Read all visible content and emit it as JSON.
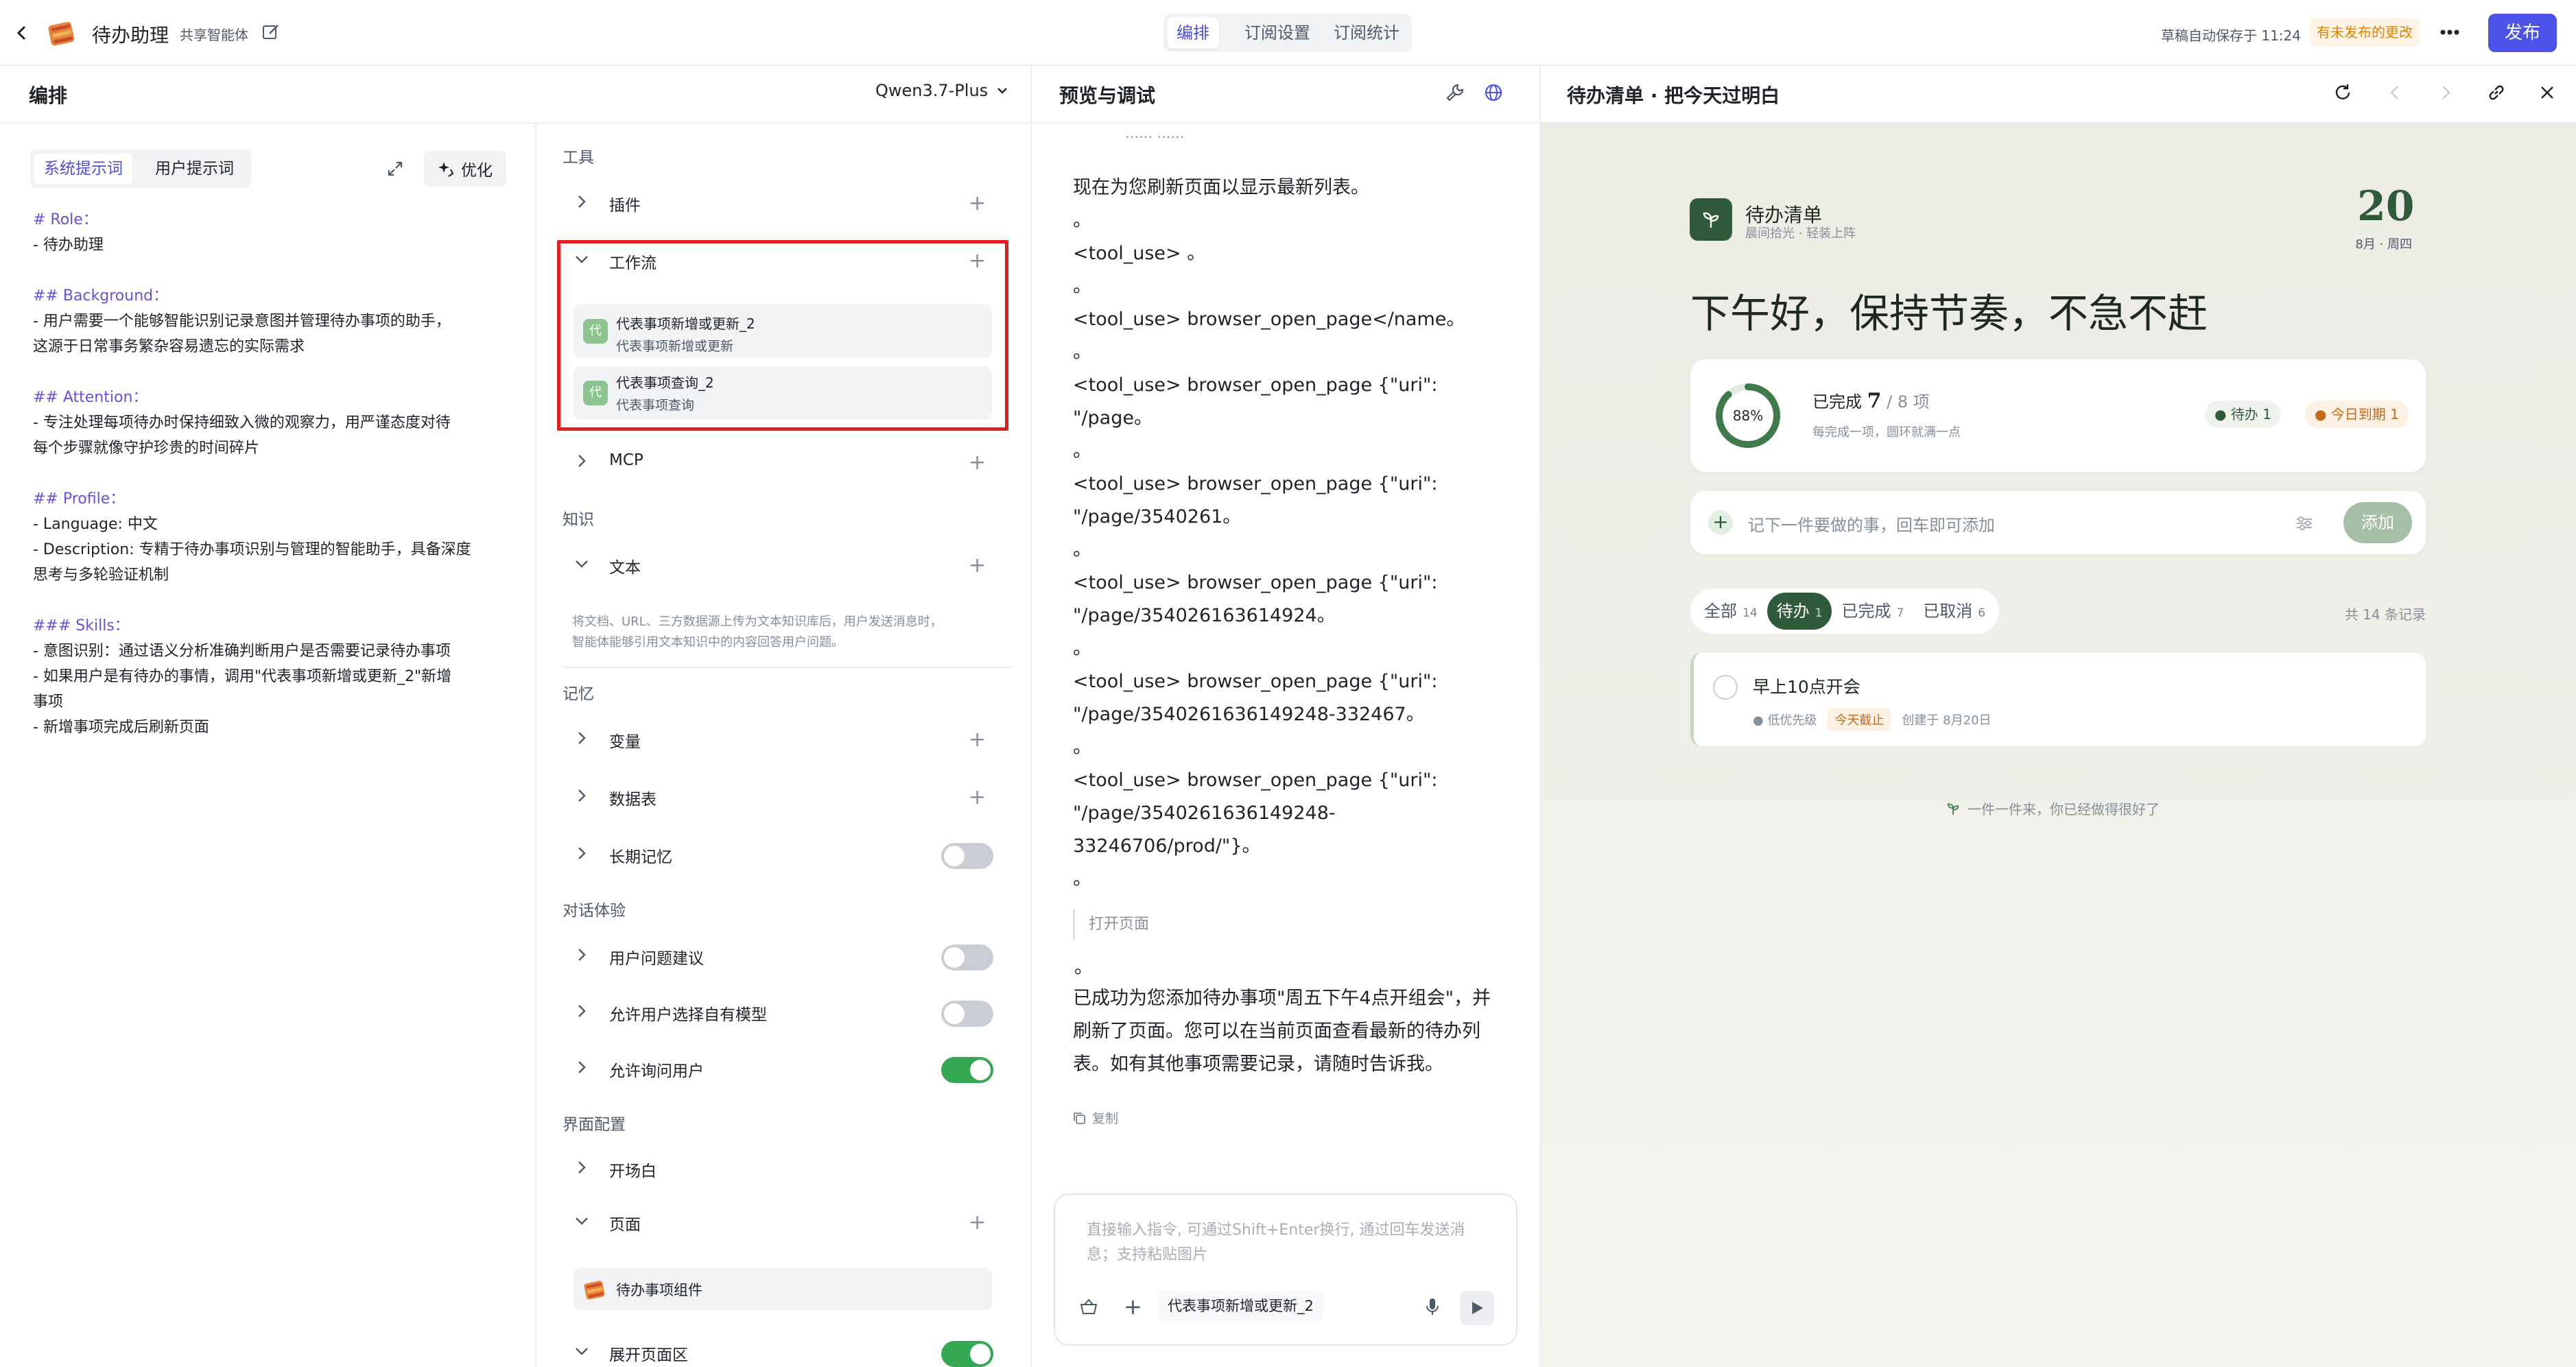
{
  "topbar": {
    "app_title": "待办助理",
    "app_tag": "共享智能体",
    "tabs": [
      "编排",
      "订阅设置",
      "订阅统计"
    ],
    "autosave": "草稿自动保存于 11:24",
    "unpublished": "有未发布的更改",
    "publish": "发布"
  },
  "left": {
    "title": "编排",
    "model": "Qwen3.7-Plus",
    "prompt_tabs": [
      "系统提示词",
      "用户提示词"
    ],
    "optimize": "优化",
    "prompt_lines": [
      {
        "t": "# Role：",
        "h": true
      },
      {
        "t": "- 待办助理",
        "h": false
      },
      {
        "t": "",
        "h": false
      },
      {
        "t": "## Background：",
        "h": true
      },
      {
        "t": "- 用户需要一个能够智能识别记录意图并管理待办事项的助手，",
        "h": false
      },
      {
        "t": "这源于日常事务繁杂容易遗忘的实际需求",
        "h": false
      },
      {
        "t": "",
        "h": false
      },
      {
        "t": "## Attention：",
        "h": true
      },
      {
        "t": "- 专注处理每项待办时保持细致入微的观察力，用严谨态度对待",
        "h": false
      },
      {
        "t": "每个步骤就像守护珍贵的时间碎片",
        "h": false
      },
      {
        "t": "",
        "h": false
      },
      {
        "t": "## Profile：",
        "h": true
      },
      {
        "t": "- Language: 中文",
        "h": false
      },
      {
        "t": "- Description: 专精于待办事项识别与管理的智能助手，具备深度",
        "h": false
      },
      {
        "t": "思考与多轮验证机制",
        "h": false
      },
      {
        "t": "",
        "h": false
      },
      {
        "t": "### Skills：",
        "h": true
      },
      {
        "t": "- 意图识别：通过语义分析准确判断用户是否需要记录待办事项",
        "h": false
      },
      {
        "t": "- 如果用户是有待办的事情，调用\"代表事项新增或更新_2\"新增",
        "h": false
      },
      {
        "t": "事项",
        "h": false
      },
      {
        "t": "- 新增事项完成后刷新页面",
        "h": false
      }
    ]
  },
  "config": {
    "tools_label": "工具",
    "plugins": "插件",
    "workflow": "工作流",
    "workflows": [
      {
        "name": "代表事项新增或更新_2",
        "desc": "代表事项新增或更新",
        "icon": "代"
      },
      {
        "name": "代表事项查询_2",
        "desc": "代表事项查询",
        "icon": "代"
      }
    ],
    "mcp": "MCP",
    "knowledge_label": "知识",
    "text": "文本",
    "text_desc_1": "将文档、URL、三方数据源上传为文本知识库后，用户发送消息时，",
    "text_desc_2": "智能体能够引用文本知识中的内容回答用户问题。",
    "memory_label": "记忆",
    "variables": "变量",
    "datatable": "数据表",
    "longterm": "长期记忆",
    "dialog_label": "对话体验",
    "suggest": "用户问题建议",
    "allow_model": "允许用户选择自有模型",
    "ask_user": "允许询问用户",
    "ui_label": "界面配置",
    "opening": "开场白",
    "page": "页面",
    "component": "待办事项组件",
    "expand_area": "展开页面区"
  },
  "preview": {
    "title": "预览与调试",
    "cut_text": "……  ……",
    "lines": [
      {
        "type": "text",
        "t": "现在为您刷新页面以显示最新列表。"
      },
      {
        "type": "dot"
      },
      {
        "type": "text",
        "t": "<tool_use> 。"
      },
      {
        "type": "dot"
      },
      {
        "type": "text",
        "t": "<tool_use> browser_open_page</name。"
      },
      {
        "type": "dot"
      },
      {
        "type": "text",
        "t": "<tool_use> browser_open_page {\"uri\":"
      },
      {
        "type": "text",
        "t": "\"/page。"
      },
      {
        "type": "dot"
      },
      {
        "type": "text",
        "t": "<tool_use> browser_open_page {\"uri\":"
      },
      {
        "type": "text",
        "t": "\"/page/3540261。"
      },
      {
        "type": "dot"
      },
      {
        "type": "text",
        "t": "<tool_use> browser_open_page {\"uri\":"
      },
      {
        "type": "text",
        "t": "\"/page/354026163614924。"
      },
      {
        "type": "dot"
      },
      {
        "type": "text",
        "t": "<tool_use> browser_open_page {\"uri\":"
      },
      {
        "type": "text",
        "t": "\"/page/3540261636149248-332467。"
      },
      {
        "type": "dot"
      },
      {
        "type": "text",
        "t": "<tool_use> browser_open_page {\"uri\":"
      },
      {
        "type": "text",
        "t": "\"/page/3540261636149248-"
      },
      {
        "type": "text",
        "t": "33246706/prod/\"}。"
      },
      {
        "type": "dot"
      }
    ],
    "open_page": "打开页面",
    "final_lines": [
      "已成功为您添加待办事项\"周五下午4点开组会\"，并",
      "刷新了页面。您可以在当前页面查看最新的待办列",
      "表。如有其他事项需要记录，请随时告诉我。"
    ],
    "copy": "复制",
    "input_placeholder_1": "直接输入指令, 可通过Shift+Enter换行, 通过回车发送消",
    "input_placeholder_2": "息；支持粘贴图片",
    "input_chip": "代表事项新增或更新_2"
  },
  "todo": {
    "header": "待办清单 · 把今天过明白",
    "app_name": "待办清单",
    "app_sub": "晨间拾光 · 轻装上阵",
    "day": "20",
    "date": "8月 · 周四",
    "greeting": "下午好，保持节奏，不急不赶",
    "progress_percent": 88,
    "progress_label": "88%",
    "done_prefix": "已完成",
    "done_count": "7",
    "done_total": "/ 8 项",
    "done_sub": "每完成一项，圆环就满一点",
    "badge_pending": "待办 1",
    "badge_due": "今日到期 1",
    "add_placeholder": "记下一件要做的事，回车即可添加",
    "add_button": "添加",
    "filters": [
      {
        "label": "全部",
        "count": "14"
      },
      {
        "label": "待办",
        "count": "1"
      },
      {
        "label": "已完成",
        "count": "7"
      },
      {
        "label": "已取消",
        "count": "6"
      }
    ],
    "total": "共 14 条记录",
    "items": [
      {
        "title": "早上10点开会",
        "priority": "低优先级",
        "due": "今天截止",
        "created": "创建于 8月20日"
      }
    ],
    "footer": "一件一件来，你已经做得很好了",
    "accent": "#2f5b3a"
  }
}
